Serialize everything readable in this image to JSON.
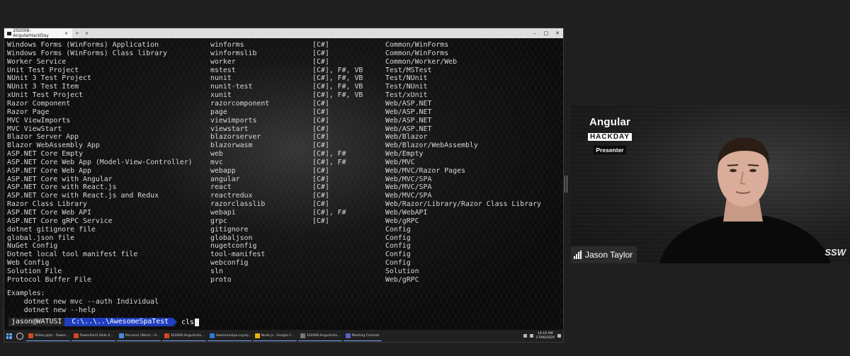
{
  "window": {
    "tab_title": "202006-AngularHackDay",
    "new_tab": "+",
    "dropdown": "∨",
    "tab_close": "✕",
    "controls": [
      "–",
      "□",
      "✕"
    ]
  },
  "terminal": {
    "rows": [
      [
        "Windows Forms (WinForms) Application",
        "winforms",
        "[C#]",
        "Common/WinForms"
      ],
      [
        "Windows Forms (WinForms) Class library",
        "winformslib",
        "[C#]",
        "Common/WinForms"
      ],
      [
        "Worker Service",
        "worker",
        "[C#]",
        "Common/Worker/Web"
      ],
      [
        "Unit Test Project",
        "mstest",
        "[C#], F#, VB",
        "Test/MSTest"
      ],
      [
        "NUnit 3 Test Project",
        "nunit",
        "[C#], F#, VB",
        "Test/NUnit"
      ],
      [
        "NUnit 3 Test Item",
        "nunit-test",
        "[C#], F#, VB",
        "Test/NUnit"
      ],
      [
        "xUnit Test Project",
        "xunit",
        "[C#], F#, VB",
        "Test/xUnit"
      ],
      [
        "Razor Component",
        "razorcomponent",
        "[C#]",
        "Web/ASP.NET"
      ],
      [
        "Razor Page",
        "page",
        "[C#]",
        "Web/ASP.NET"
      ],
      [
        "MVC ViewImports",
        "viewimports",
        "[C#]",
        "Web/ASP.NET"
      ],
      [
        "MVC ViewStart",
        "viewstart",
        "[C#]",
        "Web/ASP.NET"
      ],
      [
        "Blazor Server App",
        "blazorserver",
        "[C#]",
        "Web/Blazor"
      ],
      [
        "Blazor WebAssembly App",
        "blazorwasm",
        "[C#]",
        "Web/Blazor/WebAssembly"
      ],
      [
        "ASP.NET Core Empty",
        "web",
        "[C#], F#",
        "Web/Empty"
      ],
      [
        "ASP.NET Core Web App (Model-View-Controller)",
        "mvc",
        "[C#], F#",
        "Web/MVC"
      ],
      [
        "ASP.NET Core Web App",
        "webapp",
        "[C#]",
        "Web/MVC/Razor Pages"
      ],
      [
        "ASP.NET Core with Angular",
        "angular",
        "[C#]",
        "Web/MVC/SPA"
      ],
      [
        "ASP.NET Core with React.js",
        "react",
        "[C#]",
        "Web/MVC/SPA"
      ],
      [
        "ASP.NET Core with React.js and Redux",
        "reactredux",
        "[C#]",
        "Web/MVC/SPA"
      ],
      [
        "Razor Class Library",
        "razorclasslib",
        "[C#]",
        "Web/Razor/Library/Razor Class Library"
      ],
      [
        "ASP.NET Core Web API",
        "webapi",
        "[C#], F#",
        "Web/WebAPI"
      ],
      [
        "ASP.NET Core gRPC Service",
        "grpc",
        "[C#]",
        "Web/gRPC"
      ],
      [
        "dotnet gitignore file",
        "gitignore",
        "",
        "Config"
      ],
      [
        "global.json file",
        "globaljson",
        "",
        "Config"
      ],
      [
        "NuGet Config",
        "nugetconfig",
        "",
        "Config"
      ],
      [
        "Dotnet local tool manifest file",
        "tool-manifest",
        "",
        "Config"
      ],
      [
        "Web Config",
        "webconfig",
        "",
        "Config"
      ],
      [
        "Solution File",
        "sln",
        "",
        "Solution"
      ],
      [
        "Protocol Buffer File",
        "proto",
        "",
        "Web/gRPC"
      ]
    ],
    "examples_heading": "Examples:",
    "example_1": "    dotnet new mvc --auth Individual",
    "example_2": "    dotnet new --help",
    "prompt_user": "jason@WATUSI",
    "prompt_path": "C:\\..\\..\\AwesomeSpaTest",
    "command": "cls"
  },
  "taskbar": {
    "apps": [
      {
        "label": "Slides.pptx - Power...",
        "color": "#d24726"
      },
      {
        "label": "PowerPoint Slide S...",
        "color": "#d24726"
      },
      {
        "label": "Personal (Work) - O...",
        "color": "#4a8cd8"
      },
      {
        "label": "202006-AngularHa...",
        "color": "#d24726"
      },
      {
        "label": "AwesomeSpa.csproj...",
        "color": "#2b7bd6"
      },
      {
        "label": "Node.js - Google C...",
        "color": "#e8b10f"
      },
      {
        "label": "202006-AngularHa...",
        "color": "#777777"
      },
      {
        "label": "Meeting Controls",
        "color": "#5b5fc7"
      }
    ],
    "time": "10:16 AM",
    "date": "27/06/2020"
  },
  "video": {
    "logo_angular": "Angular",
    "logo_hackday": "HACKDAY",
    "presenter_label": "Presenter",
    "presenter_name": "Jason Taylor",
    "watermark": "SSW",
    "accent": "#e23237"
  }
}
